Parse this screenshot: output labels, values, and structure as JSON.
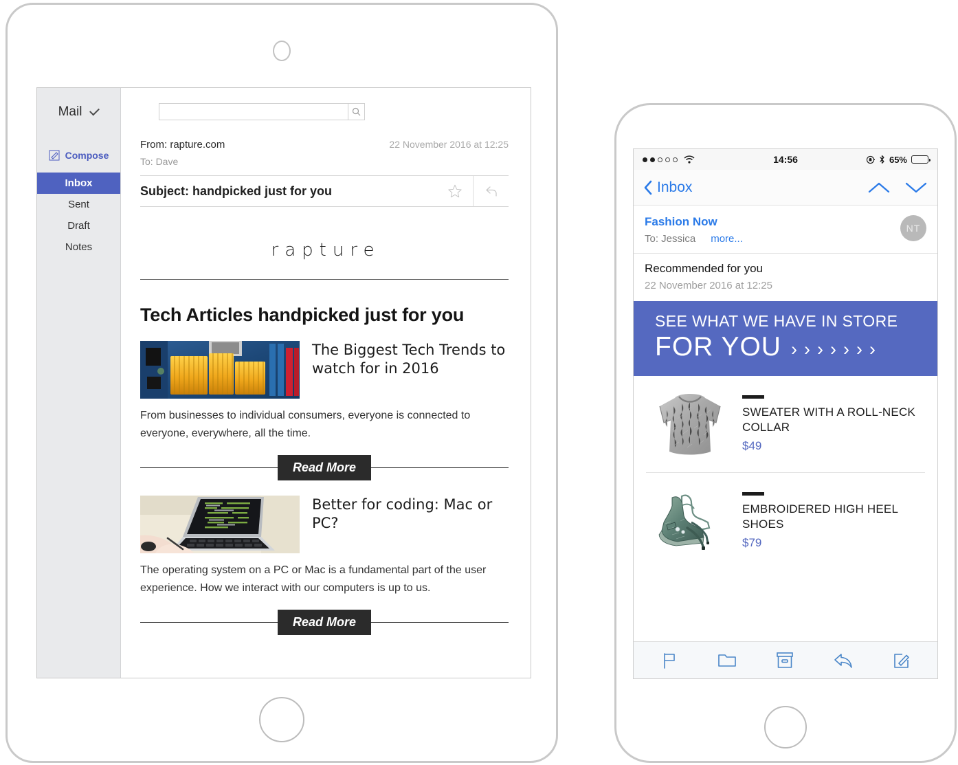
{
  "tablet": {
    "sidebar": {
      "mail_label": "Mail",
      "compose_label": "Compose",
      "items": [
        {
          "label": "Inbox",
          "active": true
        },
        {
          "label": "Sent",
          "active": false
        },
        {
          "label": "Draft",
          "active": false
        },
        {
          "label": "Notes",
          "active": false
        }
      ]
    },
    "search": {
      "value": "",
      "placeholder": ""
    },
    "email": {
      "from": "From: rapture.com",
      "to": "To: Dave",
      "date": "22 November 2016 at 12:25",
      "subject": "Subject: handpicked just for you"
    },
    "newsletter": {
      "brand": "rapture",
      "headline": "Tech Articles handpicked just for you",
      "articles": [
        {
          "title": "The Biggest Tech Trends to watch for in 2016",
          "body": "From businesses to individual consumers, everyone is connected to everyone, everywhere, all the time.",
          "cta": "Read More",
          "image": "motherboard-heatsink-photo"
        },
        {
          "title": "Better for coding: Mac or PC?",
          "body": "The operating system on a PC or Mac is a fundamental part of the user experience. How we interact with our computers is up to us.",
          "cta": "Read More",
          "image": "laptop-coding-photo"
        }
      ]
    }
  },
  "phone": {
    "status": {
      "signal_filled": 2,
      "signal_total": 5,
      "time": "14:56",
      "battery_percent": "65%",
      "battery_level": 65
    },
    "nav": {
      "back_label": "Inbox"
    },
    "email": {
      "sender": "Fashion Now",
      "to": "To: Jessica",
      "more": "more...",
      "avatar_initials": "NT",
      "subject": "Recommended for you",
      "date": "22 November 2016 at 12:25"
    },
    "banner": {
      "line1": "SEE WHAT WE HAVE IN STORE",
      "line2": "FOR YOU",
      "chevron": "›",
      "chevron_count": 7,
      "background_color": "#5569c0"
    },
    "products": [
      {
        "name": "SWEATER WITH A ROLL-NECK COLLAR",
        "price": "$49",
        "image": "grey-fuzzy-sweater-photo"
      },
      {
        "name": "EMBROIDERED HIGH HEEL SHOES",
        "price": "$79",
        "image": "teal-embroidered-heels-photo"
      }
    ],
    "toolbar": [
      {
        "icon": "flag-icon",
        "label": "Flag"
      },
      {
        "icon": "folder-icon",
        "label": "Move to folder"
      },
      {
        "icon": "archive-icon",
        "label": "Archive"
      },
      {
        "icon": "reply-icon",
        "label": "Reply"
      },
      {
        "icon": "compose-icon",
        "label": "Compose"
      }
    ]
  },
  "colors": {
    "accent_blue": "#4f62c0",
    "banner_blue": "#5569c0",
    "ios_blue": "#2a7ae8",
    "price_blue": "#5569c0"
  }
}
